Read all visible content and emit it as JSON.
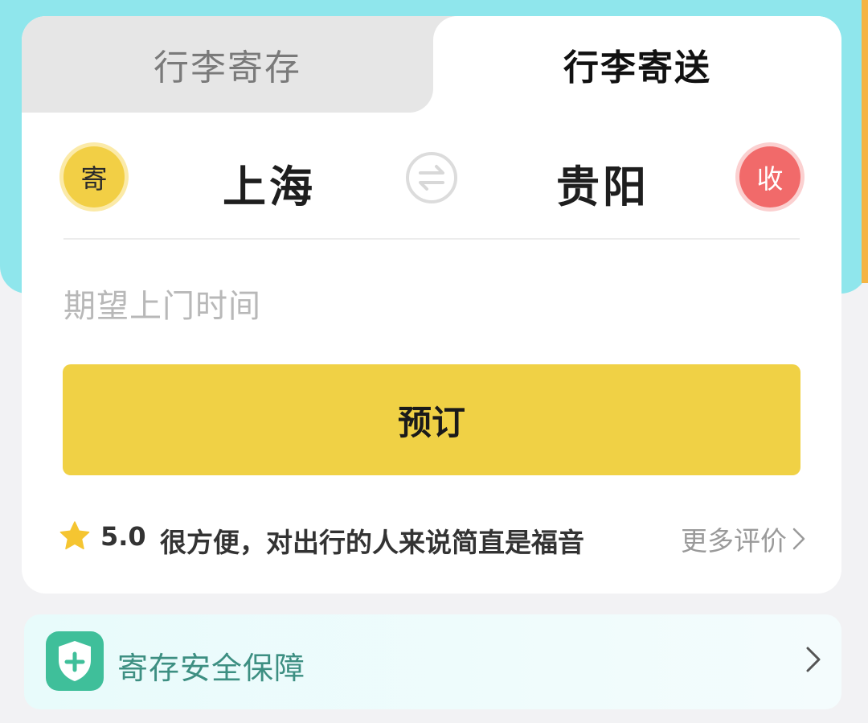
{
  "tabs": [
    {
      "label": "行李寄存",
      "active": false
    },
    {
      "label": "行李寄送",
      "active": true
    }
  ],
  "route": {
    "send_badge": "寄",
    "from_city": "上海",
    "to_city": "贵阳",
    "receive_badge": "收",
    "swap_icon": "swap-arrows-icon"
  },
  "time_field": {
    "placeholder": "期望上门时间"
  },
  "book_button": {
    "label": "预订"
  },
  "review": {
    "rating": "5.0",
    "text": "很方便，对出行的人来说简直是福音",
    "more_label": "更多评价",
    "star_icon": "star-icon"
  },
  "safety": {
    "label": "寄存安全保障",
    "icon": "shield-plus-icon"
  },
  "colors": {
    "banner": "#8fe6ec",
    "accent_yellow": "#f0d145",
    "receive_red": "#f16a6a",
    "safety_green": "#3fbf9a"
  }
}
